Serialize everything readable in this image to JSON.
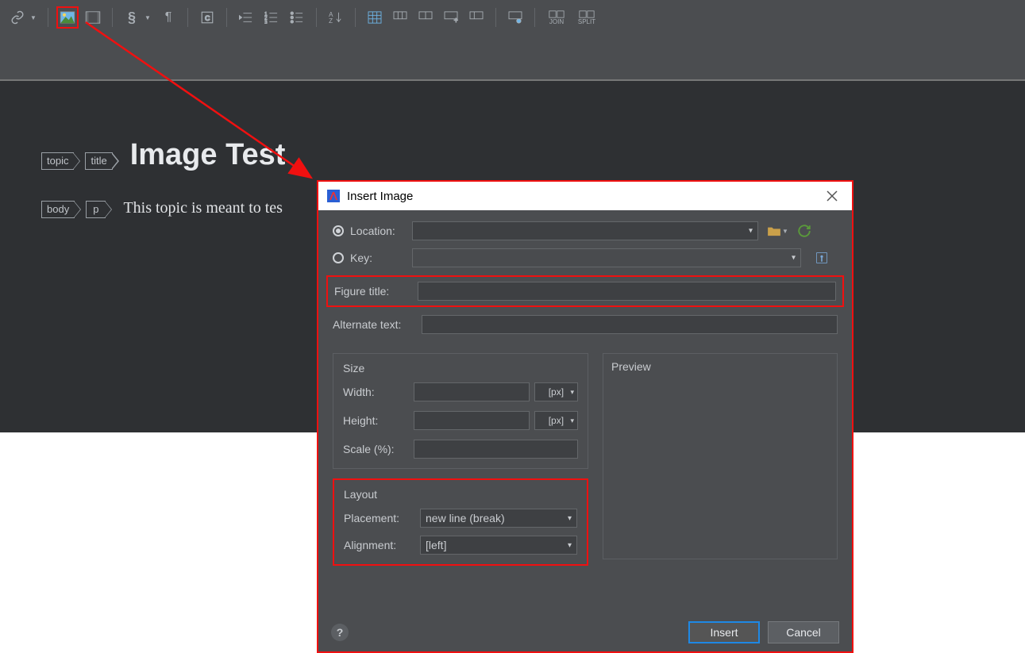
{
  "toolbar": {
    "icons": [
      "link",
      "link-dropdown",
      "image",
      "media",
      "section",
      "section-dropdown",
      "paragraph-mark",
      "code-block",
      "indent1",
      "numbered-list",
      "bullet-list",
      "sort",
      "table",
      "table-row",
      "table-ops1",
      "table-ops2",
      "table-ops3",
      "table-ops4",
      "join",
      "split"
    ],
    "join_label": "JOIN",
    "split_label": "SPLIT"
  },
  "editor": {
    "tag_topic": "topic",
    "tag_title": "title",
    "title_text": "Image Test",
    "tag_body": "body",
    "tag_p": "p",
    "body_text": "This topic is meant to tes"
  },
  "dialog": {
    "title": "Insert Image",
    "location_label": "Location:",
    "key_label": "Key:",
    "figure_title_label": "Figure title:",
    "alt_text_label": "Alternate text:",
    "size_legend": "Size",
    "width_label": "Width:",
    "height_label": "Height:",
    "scale_label": "Scale (%):",
    "unit_px": "[px]",
    "preview_legend": "Preview",
    "layout_legend": "Layout",
    "placement_label": "Placement:",
    "placement_value": "new line (break)",
    "alignment_label": "Alignment:",
    "alignment_value": "[left]",
    "insert_btn": "Insert",
    "cancel_btn": "Cancel"
  }
}
